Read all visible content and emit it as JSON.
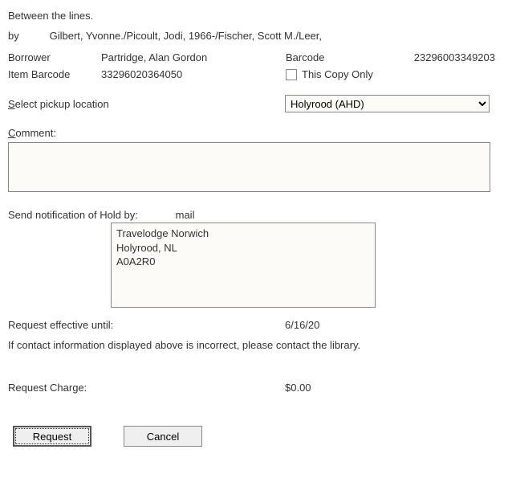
{
  "title": "Between the lines.",
  "byline": {
    "label": "by",
    "authors": "Gilbert, Yvonne./Picoult, Jodi, 1966-/Fischer, Scott M./Leer,"
  },
  "borrower": {
    "label": "Borrower",
    "name": "Partridge, Alan Gordon"
  },
  "barcode": {
    "label": "Barcode",
    "value": "23296003349203"
  },
  "item_barcode": {
    "label": "Item Barcode",
    "value": "33296020364050"
  },
  "this_copy_only": {
    "label": "This Copy Only",
    "checked": false
  },
  "pickup": {
    "label": "Select pickup location",
    "selected": "Holyrood (AHD)"
  },
  "comment": {
    "label": "Comment:",
    "value": ""
  },
  "notification": {
    "label": "Send notification of Hold by:",
    "method": "mail",
    "address": {
      "line1": "Travelodge Norwich",
      "line2": "Holyrood, NL",
      "line3": "A0A2R0"
    }
  },
  "effective_until": {
    "label": "Request effective until:",
    "value": "6/16/20"
  },
  "contact_note": "If contact information displayed above is incorrect, please contact the library.",
  "request_charge": {
    "label": "Request Charge:",
    "value": "$0.00"
  },
  "buttons": {
    "request": "Request",
    "cancel": "Cancel"
  }
}
